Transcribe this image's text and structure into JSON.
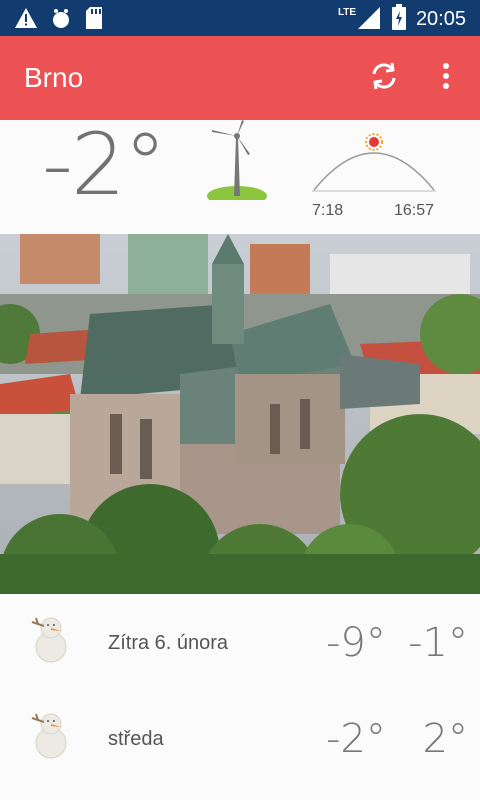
{
  "status_bar": {
    "time": "20:05",
    "network_label": "LTE",
    "icons": [
      "warning-icon",
      "bug-icon",
      "sd-card-icon",
      "lte-icon",
      "signal-icon",
      "battery-charging-icon"
    ]
  },
  "app_bar": {
    "title": "Brno",
    "background": "#ec5153",
    "actions": [
      "refresh-icon",
      "more-vert-icon"
    ]
  },
  "current": {
    "temperature": "-2°",
    "condition_icon": "wind-turbine-icon",
    "sunrise": "7:18",
    "sunset": "16:57",
    "sun_icon": "sun-arc-icon"
  },
  "photo": {
    "icon": "city-photo"
  },
  "forecast": [
    {
      "day": "Zítra 6. února",
      "min": "-9°",
      "max": "-1°",
      "icon": "snowman-icon"
    },
    {
      "day": "středa",
      "min": "-2°",
      "max": "2°",
      "icon": "snowman-icon"
    }
  ]
}
